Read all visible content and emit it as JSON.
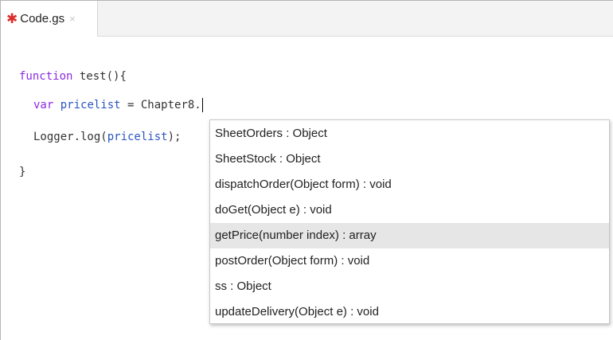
{
  "tab": {
    "modified_marker": "✱",
    "filename": "Code.gs",
    "close_glyph": "×"
  },
  "editor": {
    "line1": {
      "keyword": "function",
      "rest": " test(){"
    },
    "line2": {
      "keyword": "var",
      "space": " ",
      "name": "pricelist",
      "rest": " = Chapter8."
    },
    "line3": {
      "prefix": "Logger.log(",
      "arg": "pricelist",
      "suffix": ");"
    },
    "line4": {
      "text": "}"
    }
  },
  "autocomplete": {
    "selected_index": 4,
    "items": [
      "SheetOrders : Object",
      "SheetStock : Object",
      "dispatchOrder(Object form) : void",
      "doGet(Object e) : void",
      "getPrice(number index) : array",
      "postOrder(Object form) : void",
      "ss : Object",
      "updateDelivery(Object e) : void"
    ]
  },
  "colors": {
    "keyword": "#8a2be2",
    "variable": "#2a55c0",
    "modified_marker": "#dd2c2c",
    "selected_row": "#e6e6e6"
  }
}
